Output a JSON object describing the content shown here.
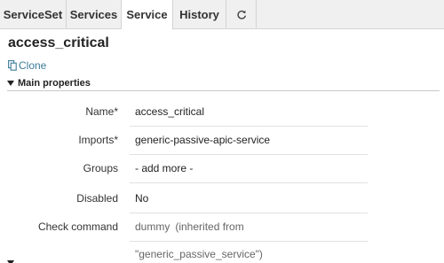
{
  "tabs": [
    {
      "label": "ServiceSet",
      "active": false
    },
    {
      "label": "Services",
      "active": false
    },
    {
      "label": "Service",
      "active": true
    },
    {
      "label": "History",
      "active": false
    }
  ],
  "refresh_icon": "refresh-icon",
  "page_title": "access_critical",
  "clone_label": "Clone",
  "clone_icon": "copy-icon",
  "section_main": "Main properties",
  "properties": {
    "name": {
      "label": "Name*",
      "value": "access_critical"
    },
    "imports": {
      "label": "Imports*",
      "value": "generic-passive-apic-service"
    },
    "groups": {
      "label": "Groups",
      "value": "- add more -"
    },
    "disabled": {
      "label": "Disabled",
      "value": "No"
    },
    "check_command": {
      "label": "Check command",
      "value": "dummy",
      "inherited": "(inherited from \"generic_passive_service\")"
    }
  },
  "colors": {
    "link": "#3c7c99",
    "tabbar_bg": "#f0f0f0",
    "active_tab_bg": "#ffffff"
  }
}
